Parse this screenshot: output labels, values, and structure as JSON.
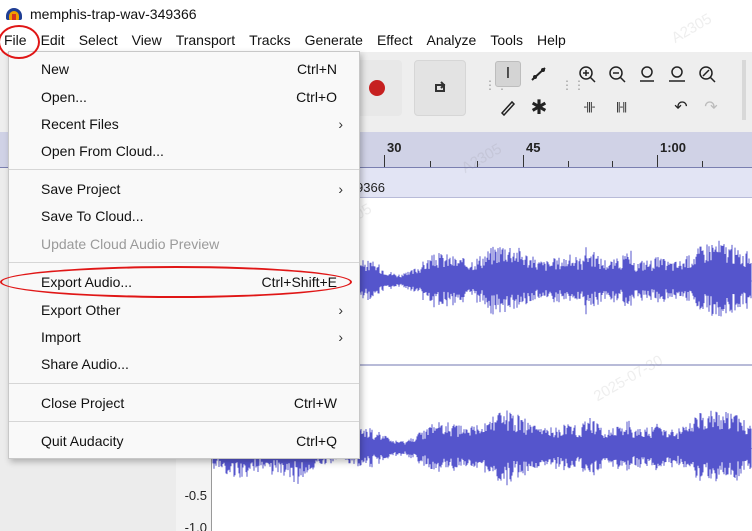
{
  "window": {
    "title": "memphis-trap-wav-349366"
  },
  "menubar": {
    "items": [
      "File",
      "Edit",
      "Select",
      "View",
      "Transport",
      "Tracks",
      "Generate",
      "Effect",
      "Analyze",
      "Tools",
      "Help"
    ]
  },
  "file_menu": {
    "items": [
      {
        "label": "New",
        "shortcut": "Ctrl+N"
      },
      {
        "label": "Open...",
        "shortcut": "Ctrl+O"
      },
      {
        "label": "Recent Files",
        "submenu": "›"
      },
      {
        "label": "Open From Cloud..."
      },
      {
        "label": "Save Project",
        "submenu": "›"
      },
      {
        "label": "Save To Cloud..."
      },
      {
        "label": "Update Cloud Audio Preview",
        "disabled": true
      },
      {
        "label": "Export Audio...",
        "shortcut": "Ctrl+Shift+E"
      },
      {
        "label": "Export Other",
        "submenu": "›"
      },
      {
        "label": "Import",
        "submenu": "›"
      },
      {
        "label": "Share Audio..."
      },
      {
        "label": "Close Project",
        "shortcut": "Ctrl+W"
      },
      {
        "label": "Quit Audacity",
        "shortcut": "Ctrl+Q"
      }
    ]
  },
  "ruler": {
    "labels": [
      "30",
      "45",
      "1:00"
    ]
  },
  "track": {
    "name_fragment": "9366",
    "scale_labels": [
      "-0.5",
      "-1.0"
    ]
  },
  "toolbar": {
    "icons": [
      "record-icon",
      "loop-icon",
      "selection-tool-icon",
      "envelope-tool-icon",
      "draw-tool-icon",
      "multi-tool-icon",
      "zoom-in-icon",
      "zoom-out-icon",
      "fit-selection-icon",
      "fit-project-icon",
      "zoom-toggle-icon",
      "trim-icon",
      "silence-icon",
      "undo-icon",
      "redo-icon"
    ]
  },
  "watermark": {
    "lines": [
      "A2305",
      "2025-07-30"
    ]
  },
  "colors": {
    "waveform": "#5555cc",
    "annotation": "#e01616",
    "ruler": "#d0d2e6"
  }
}
